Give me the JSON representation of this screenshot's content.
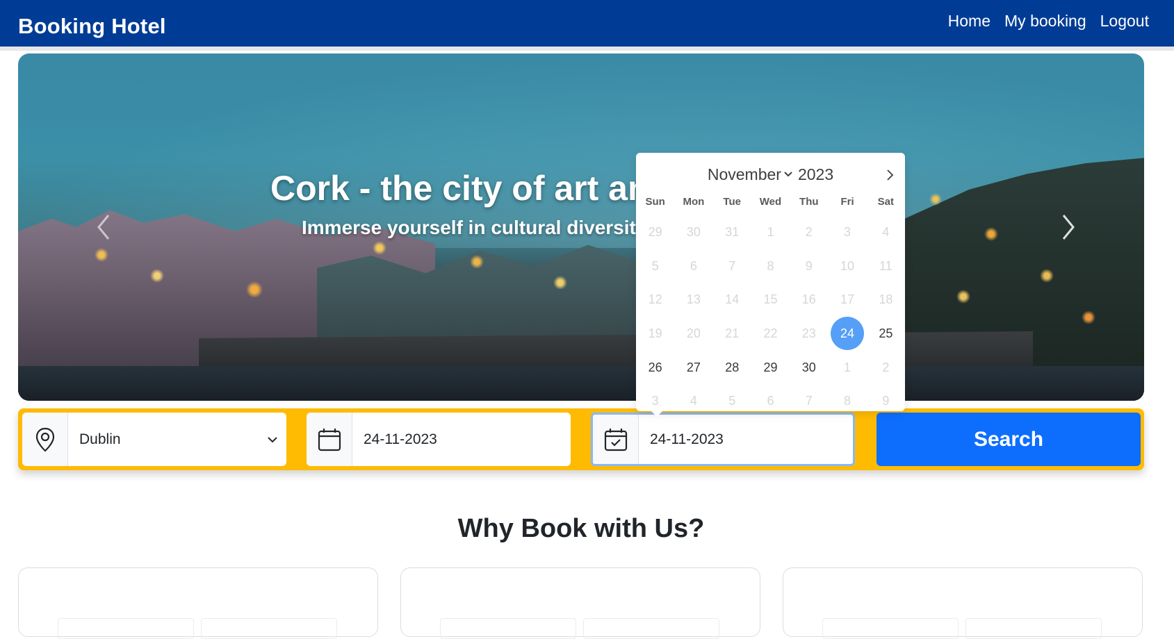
{
  "navbar": {
    "brand": "Booking Hotel",
    "links": [
      {
        "label": "Home"
      },
      {
        "label": "My booking"
      },
      {
        "label": "Logout"
      }
    ]
  },
  "hero": {
    "title": "Cork - the city of art an",
    "subtitle": "Immerse yourself in cultural diversit"
  },
  "search": {
    "location": "Dublin",
    "checkin": "24-11-2023",
    "checkout": "24-11-2023",
    "button_label": "Search"
  },
  "calendar": {
    "month": "November",
    "year": "2023",
    "weekdays": [
      "Sun",
      "Mon",
      "Tue",
      "Wed",
      "Thu",
      "Fri",
      "Sat"
    ],
    "days": [
      {
        "d": "29",
        "m": true
      },
      {
        "d": "30",
        "m": true
      },
      {
        "d": "31",
        "m": true
      },
      {
        "d": "1",
        "m": true
      },
      {
        "d": "2",
        "m": true
      },
      {
        "d": "3",
        "m": true
      },
      {
        "d": "4",
        "m": true
      },
      {
        "d": "5",
        "m": true
      },
      {
        "d": "6",
        "m": true
      },
      {
        "d": "7",
        "m": true
      },
      {
        "d": "8",
        "m": true
      },
      {
        "d": "9",
        "m": true
      },
      {
        "d": "10",
        "m": true
      },
      {
        "d": "11",
        "m": true
      },
      {
        "d": "12",
        "m": true
      },
      {
        "d": "13",
        "m": true
      },
      {
        "d": "14",
        "m": true
      },
      {
        "d": "15",
        "m": true
      },
      {
        "d": "16",
        "m": true
      },
      {
        "d": "17",
        "m": true
      },
      {
        "d": "18",
        "m": true
      },
      {
        "d": "19",
        "m": true
      },
      {
        "d": "20",
        "m": true
      },
      {
        "d": "21",
        "m": true
      },
      {
        "d": "22",
        "m": true
      },
      {
        "d": "23",
        "m": true
      },
      {
        "d": "24",
        "s": true
      },
      {
        "d": "25"
      },
      {
        "d": "26"
      },
      {
        "d": "27"
      },
      {
        "d": "28"
      },
      {
        "d": "29"
      },
      {
        "d": "30"
      },
      {
        "d": "1",
        "m": true
      },
      {
        "d": "2",
        "m": true
      },
      {
        "d": "3",
        "m": true
      },
      {
        "d": "4",
        "m": true
      },
      {
        "d": "5",
        "m": true
      },
      {
        "d": "6",
        "m": true
      },
      {
        "d": "7",
        "m": true
      },
      {
        "d": "8",
        "m": true
      },
      {
        "d": "9",
        "m": true
      }
    ]
  },
  "why": {
    "title": "Why Book with Us?"
  },
  "colors": {
    "navbar": "#003c96",
    "search_bar": "#febb02",
    "search_button": "#0d6efd",
    "selected_day": "#569ff7"
  }
}
